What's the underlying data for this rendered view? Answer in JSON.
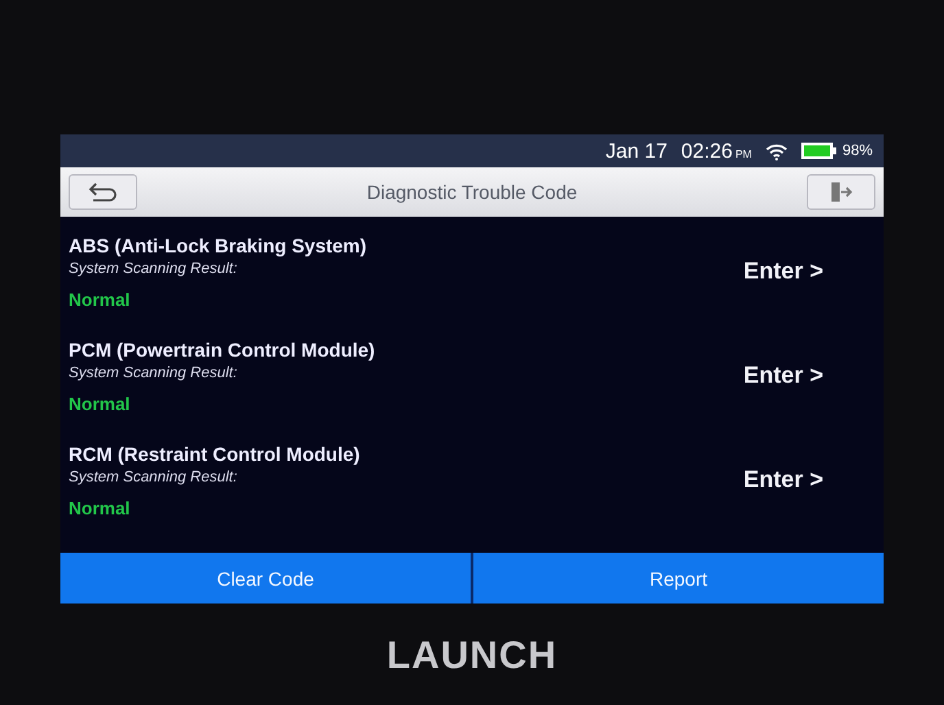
{
  "status_bar": {
    "date": "Jan 17",
    "time": "02:26",
    "ampm": "PM",
    "battery": "98%"
  },
  "title_bar": {
    "title": "Diagnostic Trouble Code"
  },
  "modules": [
    {
      "name": "ABS (Anti-Lock Braking System)",
      "label": "System Scanning Result:",
      "result": "Normal",
      "action": "Enter >"
    },
    {
      "name": "PCM (Powertrain Control Module)",
      "label": "System Scanning Result:",
      "result": "Normal",
      "action": "Enter >"
    },
    {
      "name": "RCM (Restraint Control Module)",
      "label": "System Scanning Result:",
      "result": "Normal",
      "action": "Enter >"
    }
  ],
  "buttons": [
    "Clear Code",
    "Report"
  ],
  "device": {
    "brand": "LAUNCH"
  }
}
